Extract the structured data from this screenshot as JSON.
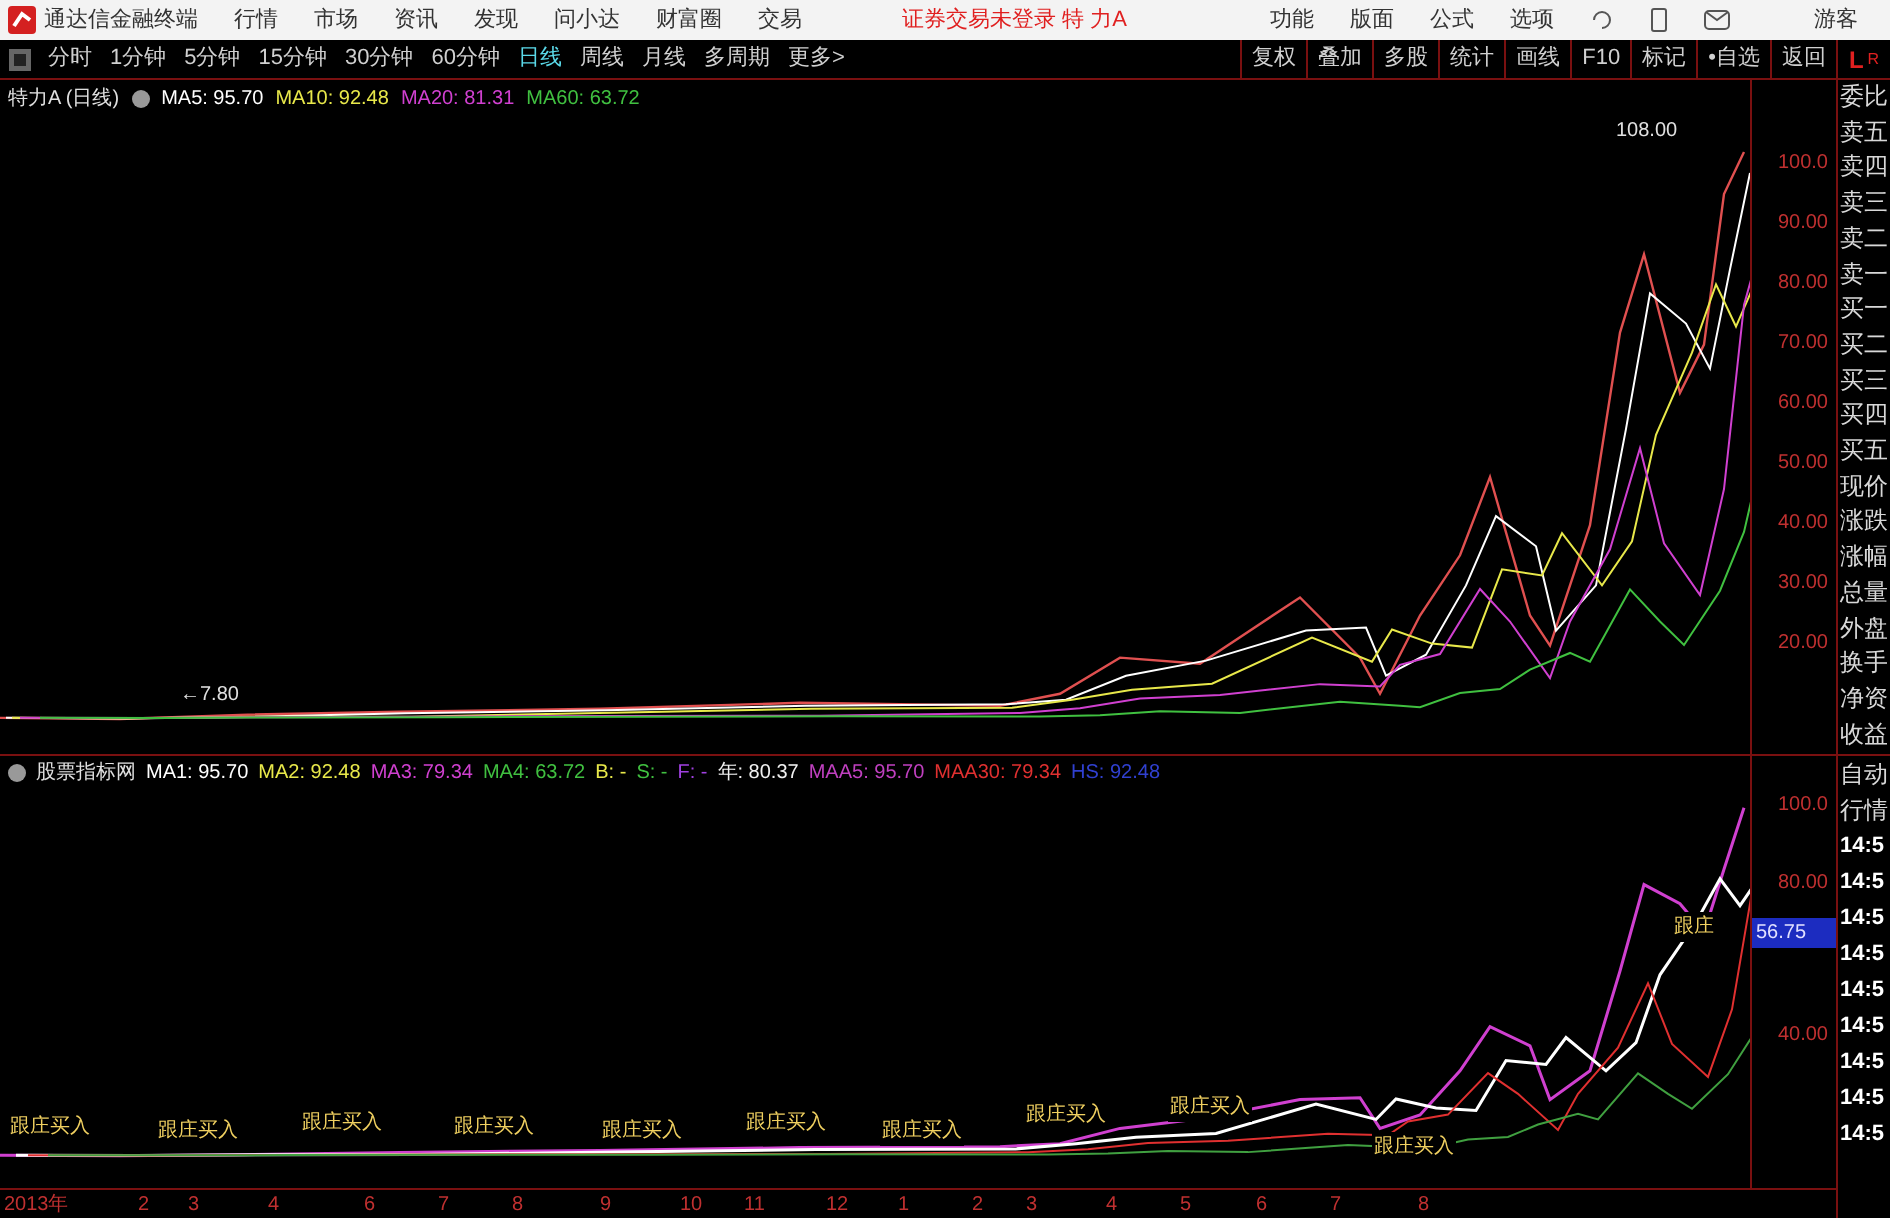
{
  "menubar": {
    "app_name": "通达信金融终端",
    "menus": [
      "行情",
      "市场",
      "资讯",
      "发现",
      "问小达",
      "财富圈",
      "交易"
    ],
    "status": "证券交易未登录  特 力A",
    "right_items": [
      "功能",
      "版面",
      "公式",
      "选项"
    ],
    "user": "游客"
  },
  "toolbar": {
    "periods": [
      {
        "label": "分时",
        "selected": false
      },
      {
        "label": "1分钟",
        "selected": false
      },
      {
        "label": "5分钟",
        "selected": false
      },
      {
        "label": "15分钟",
        "selected": false
      },
      {
        "label": "30分钟",
        "selected": false
      },
      {
        "label": "60分钟",
        "selected": false
      },
      {
        "label": "日线",
        "selected": true
      },
      {
        "label": "周线",
        "selected": false
      },
      {
        "label": "月线",
        "selected": false
      },
      {
        "label": "多周期",
        "selected": false
      },
      {
        "label": "更多>",
        "selected": false
      }
    ],
    "buttons": [
      "复权",
      "叠加",
      "多股",
      "统计",
      "画线",
      "F10",
      "标记",
      "•自选",
      "返回"
    ],
    "corner_left": "L",
    "corner_right": "R"
  },
  "main_chart": {
    "title": "特力A (日线)",
    "legend": [
      {
        "label": "MA5: 95.70",
        "color": "#ffffff"
      },
      {
        "label": "MA10: 92.48",
        "color": "#e8e84a"
      },
      {
        "label": "MA20: 81.31",
        "color": "#d040d0"
      },
      {
        "label": "MA60: 63.72",
        "color": "#40c040"
      }
    ],
    "high_label": "108.00",
    "low_label": "←7.80",
    "yaxis": [
      "100.0",
      "90.00",
      "80.00",
      "70.00",
      "60.00",
      "50.00",
      "40.00",
      "30.00",
      "20.00"
    ]
  },
  "indicator_chart": {
    "title": "股票指标网",
    "legend": [
      {
        "label": "MA1: 95.70",
        "color": "#ffffff"
      },
      {
        "label": "MA2: 92.48",
        "color": "#e8e84a"
      },
      {
        "label": "MA3: 79.34",
        "color": "#d040d0"
      },
      {
        "label": "MA4: 63.72",
        "color": "#40c040"
      },
      {
        "label": "B: -",
        "color": "#e8e84a"
      },
      {
        "label": "S: -",
        "color": "#40c040"
      },
      {
        "label": "F: -",
        "color": "#a040e0"
      },
      {
        "label": "年: 80.37",
        "color": "#f0f0f0"
      },
      {
        "label": "MAA5: 95.70",
        "color": "#c040c0"
      },
      {
        "label": "MAA30: 79.34",
        "color": "#e03030"
      },
      {
        "label": "HS: 92.48",
        "color": "#3040d0"
      }
    ],
    "signals": [
      "跟庄买入",
      "跟庄买入",
      "跟庄买入",
      "跟庄买入",
      "跟庄买入",
      "跟庄买入",
      "跟庄买入",
      "跟庄买入",
      "跟庄买入",
      "跟庄买入",
      "跟庄"
    ],
    "yaxis": [
      "100.0",
      "80.00",
      "40.00"
    ],
    "current_value": "56.75"
  },
  "xaxis": [
    "2013年",
    "2",
    "3",
    "4",
    "6",
    "7",
    "8",
    "9",
    "10",
    "11",
    "12",
    "1",
    "2",
    "3",
    "4",
    "5",
    "6",
    "7",
    "8"
  ],
  "quote_panel": {
    "labels": [
      "委比",
      "卖五",
      "卖四",
      "卖三",
      "卖二",
      "卖一",
      "买一",
      "买二",
      "买三",
      "买四",
      "买五",
      "现价",
      "涨跌",
      "涨幅",
      "总量",
      "外盘",
      "换手",
      "净资",
      "收益"
    ],
    "lower_labels": [
      "自动",
      "行情"
    ],
    "times": [
      "14:5",
      "14:5",
      "14:5",
      "14:5",
      "14:5",
      "14:5",
      "14:5",
      "14:5",
      "14:5"
    ]
  }
}
